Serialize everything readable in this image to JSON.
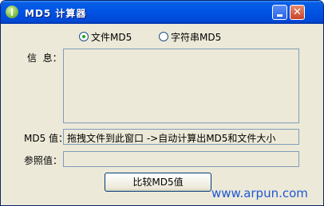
{
  "window": {
    "title": "MD5 计算器"
  },
  "mode": {
    "options": [
      {
        "label": "文件MD5",
        "selected": true
      },
      {
        "label": "字符串MD5",
        "selected": false
      }
    ]
  },
  "info": {
    "label": "信  息：",
    "text": ""
  },
  "md5": {
    "label": "MD5 值：",
    "value": "拖拽文件到此窗口 ->自动计算出MD5和文件大小"
  },
  "reference": {
    "label": "参照值：",
    "value": ""
  },
  "compare_button": {
    "label": "比较MD5值"
  },
  "watermark": {
    "text": "www.arpun.com"
  },
  "colors": {
    "accent": "#0055e5",
    "radio_dot": "#21a121"
  }
}
